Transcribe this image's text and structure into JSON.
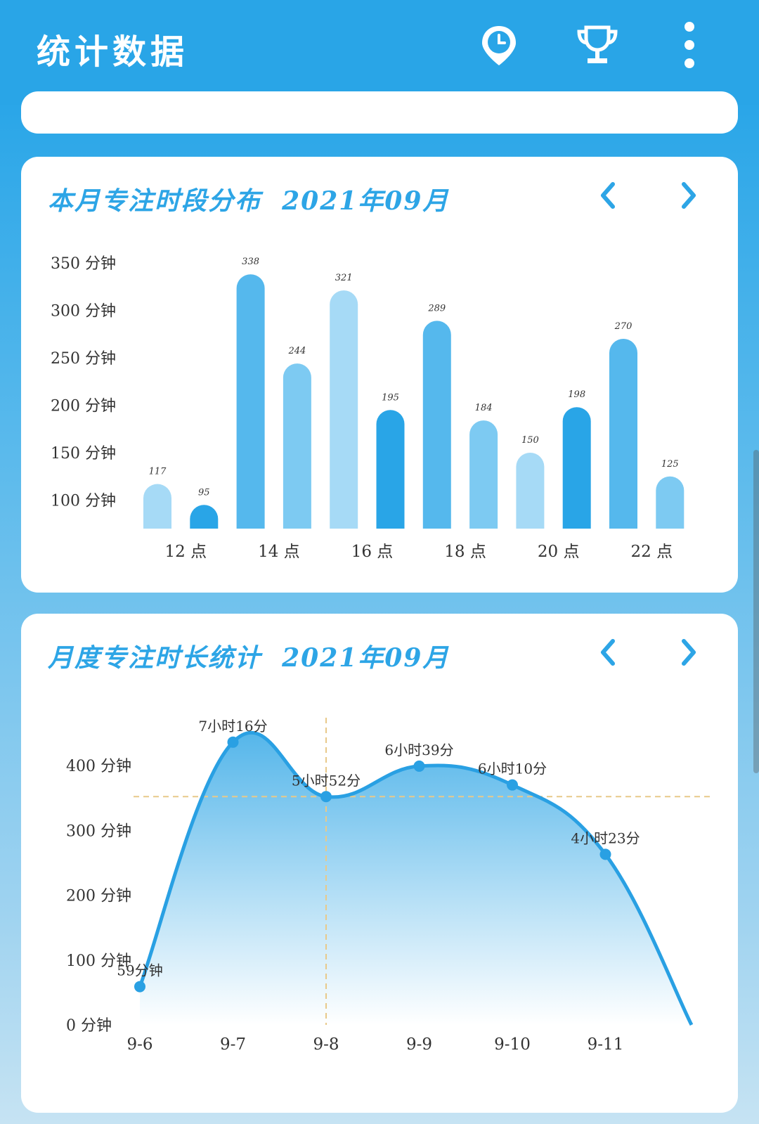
{
  "app": {
    "title": "统计数据",
    "icons": [
      "history-icon",
      "trophy-icon",
      "more-vert-icon"
    ]
  },
  "colors": {
    "primary": "#29a5e7",
    "bar_dark": "#29a5e7",
    "bar_mid": "#55b8ed",
    "bar_light": "#7dcaf2",
    "bar_pale": "#a6daf6",
    "reference_line": "#e8c98a"
  },
  "card1": {
    "title": "本月专注时段分布",
    "month": "2021年09月"
  },
  "card2": {
    "title": "月度专注时长统计",
    "month": "2021年09月"
  },
  "chart_data": [
    {
      "type": "bar",
      "title": "本月专注时段分布 2021年09月",
      "y_unit": "分钟",
      "y_ticks": [
        "100 分钟",
        "150 分钟",
        "200 分钟",
        "250 分钟",
        "300 分钟",
        "350 分钟"
      ],
      "x_ticks": [
        "12 点",
        "14 点",
        "16 点",
        "18 点",
        "20 点",
        "22 点"
      ],
      "ylim": [
        70,
        370
      ],
      "values": [
        117,
        95,
        338,
        244,
        321,
        195,
        289,
        184,
        150,
        198,
        270,
        125
      ],
      "value_labels": [
        "117",
        "95",
        "338",
        "244",
        "321",
        "195",
        "289",
        "184",
        "150",
        "198",
        "270",
        "125"
      ],
      "bar_color_keys": [
        "bar_pale",
        "bar_dark",
        "bar_mid",
        "bar_light",
        "bar_pale",
        "bar_dark",
        "bar_mid",
        "bar_light",
        "bar_pale",
        "bar_dark",
        "bar_mid",
        "bar_light"
      ]
    },
    {
      "type": "area",
      "title": "月度专注时长统计 2021年09月",
      "y_unit": "分钟",
      "y_ticks": [
        "0 分钟",
        "100 分钟",
        "200 分钟",
        "300 分钟",
        "400 分钟"
      ],
      "x": [
        "9-6",
        "9-7",
        "9-8",
        "9-9",
        "9-10",
        "9-11"
      ],
      "ylim": [
        0,
        440
      ],
      "values": [
        59,
        436,
        352,
        399,
        370,
        263
      ],
      "point_labels": [
        "59分钟",
        "7小时16分",
        "5小时52分",
        "6小时39分",
        "6小时10分",
        "4小时23分"
      ],
      "tail_value": 0,
      "reference": {
        "x": "9-8",
        "y": 352
      }
    }
  ]
}
